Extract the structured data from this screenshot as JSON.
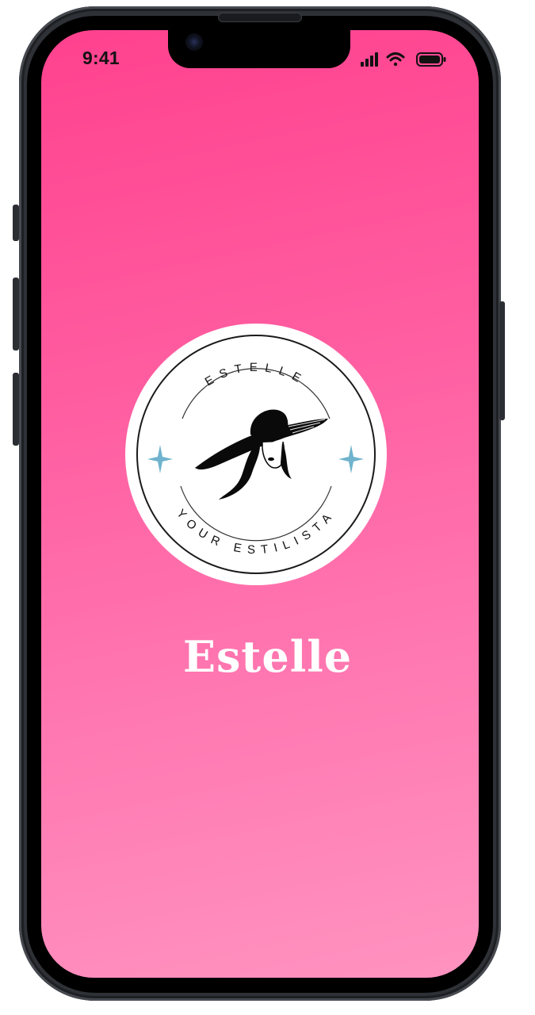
{
  "status_bar": {
    "time": "9:41",
    "icons": [
      "cellular-signal-icon",
      "wifi-icon",
      "battery-icon"
    ]
  },
  "app": {
    "title": "Estelle"
  },
  "logo": {
    "top_text": "ESTELLE",
    "bottom_text": "YOUR ESTILISTA",
    "icon": "woman-with-wide-brim-hat-logo",
    "accent_icons": [
      "sparkle-star-icon",
      "sparkle-star-icon"
    ]
  },
  "colors": {
    "background_top": "#ff418e",
    "background_bottom": "#ff93c0",
    "sparkle": "#6fb3cd",
    "title": "#ffffff"
  }
}
